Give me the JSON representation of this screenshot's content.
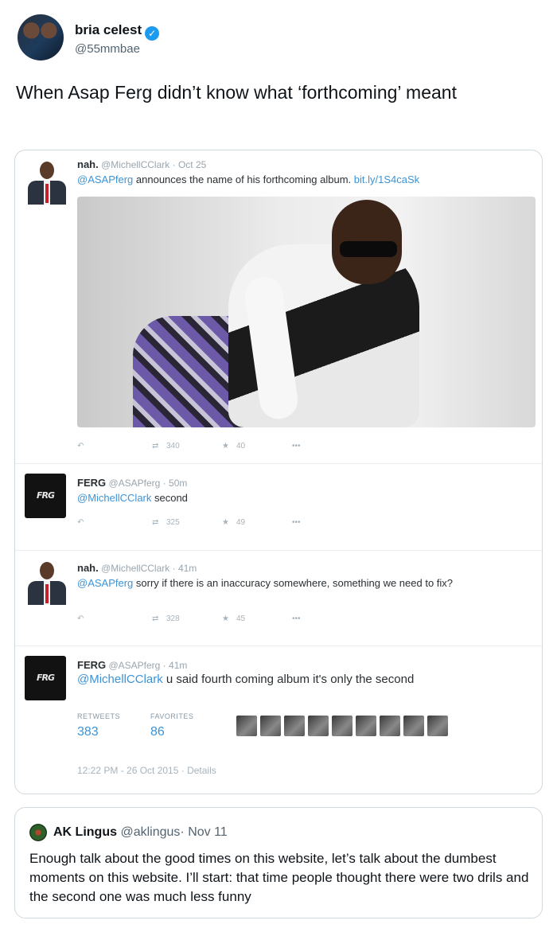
{
  "author": {
    "name": "bria celest",
    "verified_icon": "✓",
    "handle": "@55mmbae"
  },
  "main_text": "When Asap Ferg didn’t know what ‘forthcoming’ meant",
  "embedded": {
    "tweets": [
      {
        "name": "nah.",
        "handle": "@MichellCClark",
        "time": "Oct 25",
        "mention": "@ASAPferg",
        "text": " announces the name of his forthcoming album. ",
        "link": "bit.ly/1S4caSk",
        "retweets": "340",
        "favorites": "40"
      },
      {
        "name": "FERG",
        "handle": "@ASAPferg",
        "time": "50m",
        "mention": "@MichellCClark",
        "text": " second",
        "retweets": "325",
        "favorites": "49"
      },
      {
        "name": "nah.",
        "handle": "@MichellCClark",
        "time": "41m",
        "mention": "@ASAPferg",
        "text": " sorry if there is an inaccuracy somewhere, something we need to fix?",
        "retweets": "328",
        "favorites": "45"
      },
      {
        "name": "FERG",
        "handle": "@ASAPferg",
        "time": "41m",
        "mention": "@MichellCClark",
        "text": " u said fourth coming album it's only the second"
      }
    ],
    "stats": {
      "retweets_label": "RETWEETS",
      "retweets": "383",
      "favorites_label": "FAVORITES",
      "favorites": "86"
    },
    "timestamp": "12:22 PM - 26 Oct 2015",
    "details": "Details",
    "ferg_logo": "FRG"
  },
  "quote": {
    "name": "AK Lingus",
    "handle": "@aklingus",
    "time": "Nov 11",
    "text": "Enough talk about the good times on this website, let’s talk about the dumbest moments on this website. I’ll start: that time people thought there were two drils and the second one was much less funny"
  }
}
